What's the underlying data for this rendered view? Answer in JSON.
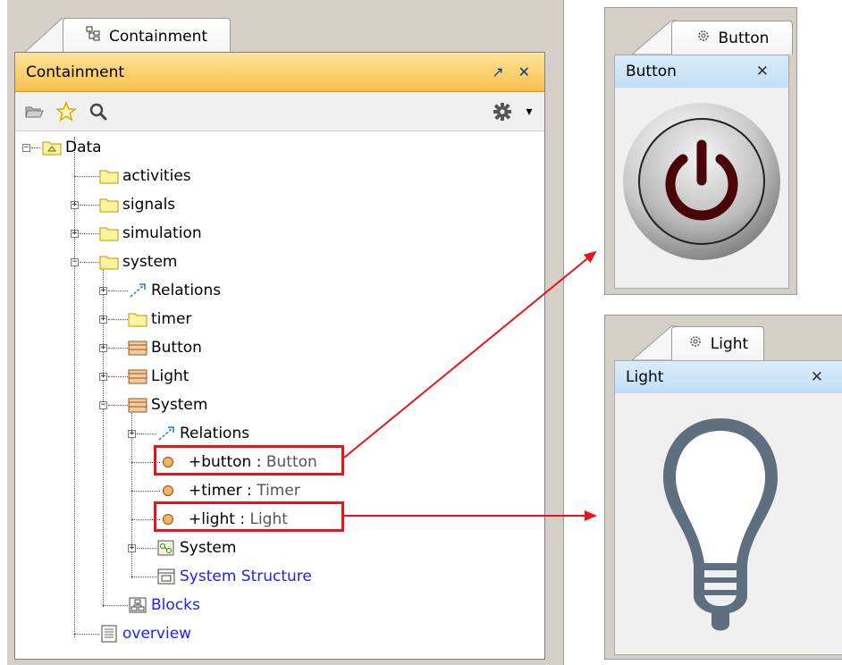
{
  "containment": {
    "tab_label": "Containment",
    "title": "Containment",
    "title_controls": {
      "float": "↗",
      "close": "✕"
    },
    "toolbar": {
      "icons": [
        "open-folder-icon",
        "star-icon",
        "search-icon",
        "gear-icon"
      ],
      "menu_arrow": "▾"
    },
    "tree": {
      "data": "Data",
      "activities": "activities",
      "signals": "signals",
      "simulation": "simulation",
      "system": "system",
      "relations": "Relations",
      "timer": "timer",
      "button": "Button",
      "light": "Light",
      "system_block": "System",
      "relations_inner": "Relations",
      "part_button_name": "+button",
      "part_button_type": "Button",
      "part_timer_name": "+timer",
      "part_timer_type": "Timer",
      "part_light_name": "+light",
      "part_light_type": "Light",
      "system_inner": "System",
      "system_structure": "System Structure",
      "blocks": "Blocks",
      "overview": "overview",
      "type_sep": " : "
    }
  },
  "button_panel": {
    "tab_label": "Button",
    "title": "Button",
    "close": "✕"
  },
  "light_panel": {
    "tab_label": "Light",
    "title": "Light",
    "close": "✕"
  },
  "colors": {
    "highlight_red": "#e8141b",
    "link_blue": "#2020ff",
    "title_orange": "#f7c04a",
    "panel_title_blue": "#c2def5"
  }
}
